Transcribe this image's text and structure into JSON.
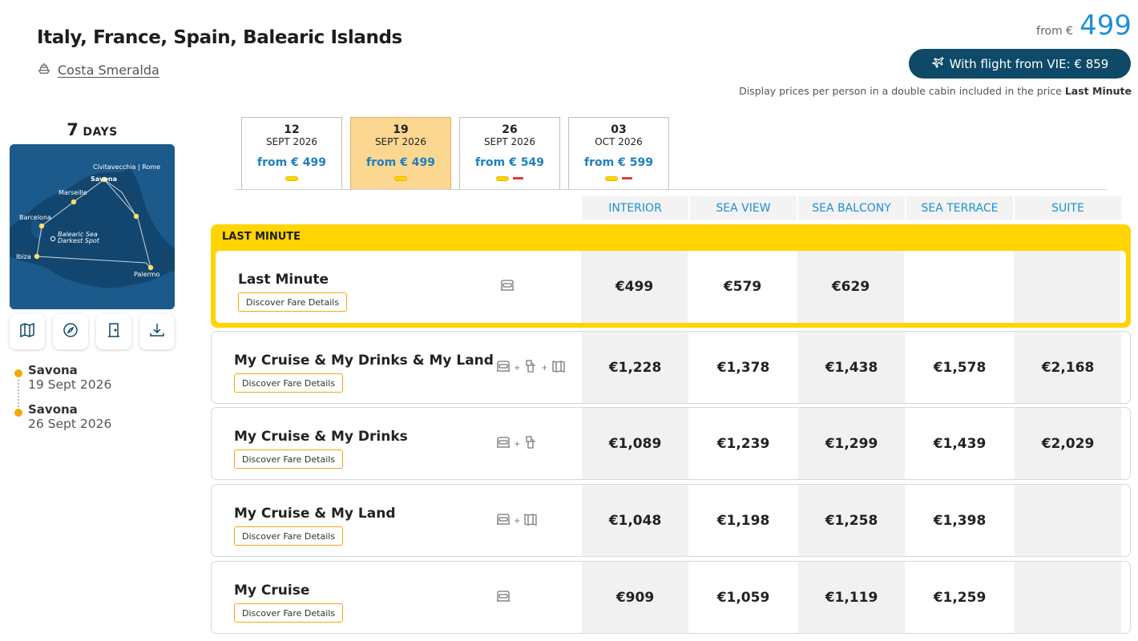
{
  "header": {
    "title": "Italy, France, Spain, Balearic Islands",
    "ship": "Costa Smeralda",
    "from_label": "from €",
    "from_price": "499",
    "flight_button": "With flight from VIE: € 859",
    "display_note": "Display prices per person in a double cabin included in the price",
    "display_note_bold": "Last Minute"
  },
  "duration": {
    "number": "7",
    "label": "DAYS"
  },
  "map": {
    "ports": [
      "Civitavecchia | Rome",
      "Savona",
      "Marseille",
      "Barcelona",
      "Balearic Sea",
      "Darkest Spot",
      "Ibiza",
      "Palermo"
    ]
  },
  "tools": [
    "map-icon",
    "compass-icon",
    "door-icon",
    "download-icon"
  ],
  "itinerary": [
    {
      "port": "Savona",
      "date": "19 Sept 2026"
    },
    {
      "port": "Savona",
      "date": "26 Sept 2026"
    }
  ],
  "date_tabs": [
    {
      "day": "12",
      "month": "SEPT 2026",
      "from": "from € 499",
      "active": false,
      "red": false
    },
    {
      "day": "19",
      "month": "SEPT 2026",
      "from": "from € 499",
      "active": true,
      "red": false
    },
    {
      "day": "26",
      "month": "SEPT 2026",
      "from": "from € 549",
      "active": false,
      "red": true
    },
    {
      "day": "03",
      "month": "OCT 2026",
      "from": "from € 599",
      "active": false,
      "red": true
    }
  ],
  "columns": [
    "INTERIOR",
    "SEA VIEW",
    "SEA BALCONY",
    "SEA TERRACE",
    "SUITE"
  ],
  "last_minute_label": "LAST MINUTE",
  "discover_label": "Discover Fare Details",
  "fares": [
    {
      "name": "Last Minute",
      "icons": [
        "cabin"
      ],
      "prices": [
        "€499",
        "€579",
        "€629",
        "",
        ""
      ]
    },
    {
      "name": "My Cruise & My Drinks & My Land",
      "icons": [
        "cabin",
        "drinks",
        "land"
      ],
      "prices": [
        "€1,228",
        "€1,378",
        "€1,438",
        "€1,578",
        "€2,168"
      ]
    },
    {
      "name": "My Cruise & My Drinks",
      "icons": [
        "cabin",
        "drinks"
      ],
      "prices": [
        "€1,089",
        "€1,239",
        "€1,299",
        "€1,439",
        "€2,029"
      ]
    },
    {
      "name": "My Cruise & My Land",
      "icons": [
        "cabin",
        "land"
      ],
      "prices": [
        "€1,048",
        "€1,198",
        "€1,258",
        "€1,398",
        ""
      ]
    },
    {
      "name": "My Cruise",
      "icons": [
        "cabin"
      ],
      "prices": [
        "€909",
        "€1,059",
        "€1,119",
        "€1,259",
        ""
      ]
    }
  ],
  "colors": {
    "accent_blue": "#1f8fd6",
    "navy": "#0e4a68",
    "yellow": "#ffd400",
    "orange": "#f3a90c",
    "tab_active": "#fbd791"
  }
}
